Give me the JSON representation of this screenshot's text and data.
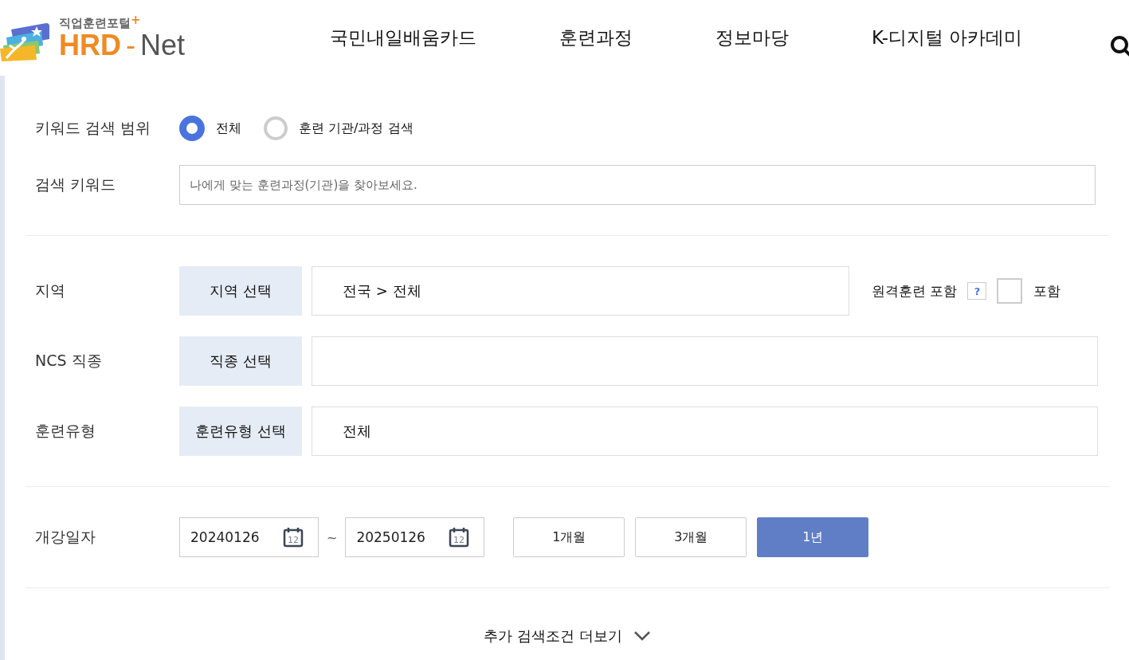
{
  "header": {
    "logo": {
      "subtitle": "직업훈련포털",
      "plus": "+",
      "brand_a": "HRD",
      "dash": "-",
      "brand_b": "Net"
    },
    "nav": [
      {
        "label": "국민내일배움카드"
      },
      {
        "label": "훈련과정"
      },
      {
        "label": "정보마당"
      },
      {
        "label": "K-디지털 아카데미"
      }
    ]
  },
  "keyword_scope": {
    "label": "키워드 검색 범위",
    "options": [
      {
        "label": "전체",
        "selected": true
      },
      {
        "label": "훈련 기관/과정 검색",
        "selected": false
      }
    ]
  },
  "keyword": {
    "label": "검색 키워드",
    "placeholder": "나에게 맞는 훈련과정(기관)을 찾아보세요."
  },
  "filters": [
    {
      "label": "지역",
      "button": "지역 선택",
      "value": "전국 > 전체",
      "remote": {
        "label": "원격훈련 포함",
        "help": "?",
        "checked": false,
        "checkbox_label": "포함"
      }
    },
    {
      "label": "NCS 직종",
      "button": "직종 선택"
    },
    {
      "label": "훈련유형",
      "button": "훈련유형 선택",
      "value": "전체"
    }
  ],
  "start_date": {
    "label": "개강일자",
    "from": {
      "value": "20240126",
      "calendar_day": "12"
    },
    "separator": "~",
    "to": {
      "value": "20250126",
      "calendar_day": "12"
    },
    "periods": [
      {
        "label": "1개월",
        "selected": false
      },
      {
        "label": "3개월",
        "selected": false
      },
      {
        "label": "1년",
        "selected": true
      }
    ]
  },
  "more": {
    "label": "추가 검색조건 더보기"
  }
}
